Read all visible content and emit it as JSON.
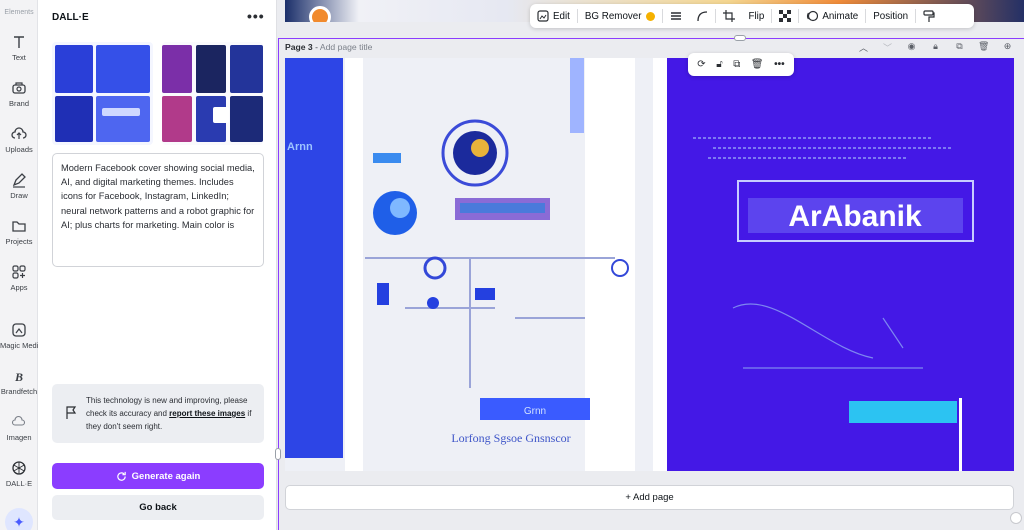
{
  "rail": {
    "top_label": "Elements",
    "items": [
      {
        "label": "Text",
        "icon": "text-icon"
      },
      {
        "label": "Brand",
        "icon": "brand-icon"
      },
      {
        "label": "Uploads",
        "icon": "upload-icon"
      },
      {
        "label": "Draw",
        "icon": "draw-icon"
      },
      {
        "label": "Projects",
        "icon": "folder-icon"
      },
      {
        "label": "Apps",
        "icon": "apps-icon"
      },
      {
        "label": "Magic Media",
        "icon": "magic-media-icon"
      },
      {
        "label": "Brandfetch",
        "icon": "brandfetch-icon"
      },
      {
        "label": "Imagen",
        "icon": "imagen-icon"
      },
      {
        "label": "DALL·E",
        "icon": "dalle-icon"
      }
    ]
  },
  "panel": {
    "title": "DALL·E",
    "more": "•••",
    "prompt": "Modern Facebook cover showing social media, AI, and digital marketing themes. Includes icons for Facebook, Instagram, LinkedIn; neural network patterns and a robot graphic for AI; plus charts for marketing. Main color is",
    "notice": {
      "text_before": "This technology is new and improving, please check its accuracy and ",
      "link": "report these images",
      "text_after": " if they don't seem right."
    },
    "generate_label": "Generate again",
    "back_label": "Go back",
    "accent": "#8b3dff"
  },
  "toolbar": {
    "edit": "Edit",
    "bg_remover": "BG Remover",
    "flip": "Flip",
    "animate": "Animate",
    "position": "Position"
  },
  "page": {
    "label": "Page 3",
    "separator": " - ",
    "title_placeholder": "Add page title"
  },
  "canvas": {
    "left_text": "Lorfong Sgsoe Gnsnscor",
    "right_headline": "ArAbanik",
    "left_button_text": "Grnn",
    "side_text": "Arnn"
  },
  "add_page_label": "+ Add page"
}
